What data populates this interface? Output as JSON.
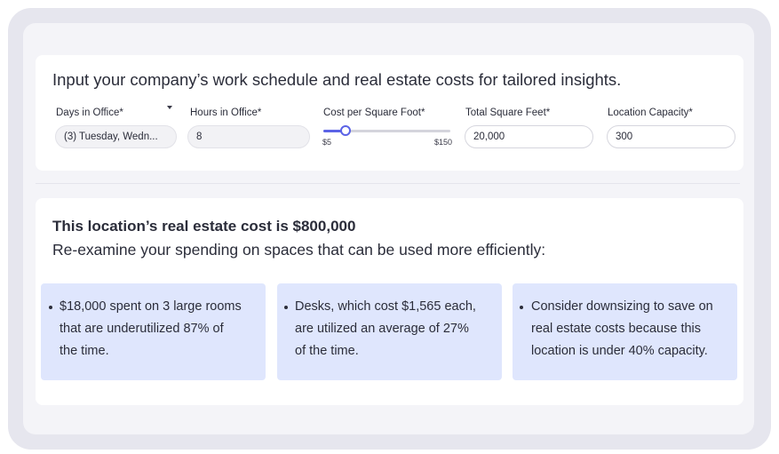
{
  "intro": "Input your company’s work schedule and real estate costs for tailored insights.",
  "fields": {
    "days": {
      "label": "Days in Office*",
      "value": "(3) Tuesday, Wedn..."
    },
    "hours": {
      "label": "Hours in Office*",
      "value": "8"
    },
    "cost": {
      "label": "Cost per Square Foot*",
      "min_label": "$5",
      "max_label": "$150",
      "min": 5,
      "max": 150,
      "value": 30
    },
    "sqft": {
      "label": "Total Square Feet*",
      "value": "20,000"
    },
    "capacity": {
      "label": "Location Capacity*",
      "value": "300"
    }
  },
  "result": {
    "headline": "This location’s real estate cost is $800,000",
    "subline": "Re-examine your spending on spaces that can be used more efficiently:"
  },
  "insights": [
    {
      "lines": [
        "$18,000 spent on 3 large rooms",
        "that are underutilized 87% of",
        "the time."
      ]
    },
    {
      "lines": [
        "Desks, which cost $1,565 each,",
        "are utilized an average of 27%",
        "of the time."
      ]
    },
    {
      "lines": [
        "Consider downsizing to save on",
        "real estate costs because this",
        "location is under 40% capacity."
      ]
    }
  ],
  "colors": {
    "accent": "#5b63e6",
    "insight_bg": "#dfe6fd",
    "text": "#2b2d3a"
  }
}
